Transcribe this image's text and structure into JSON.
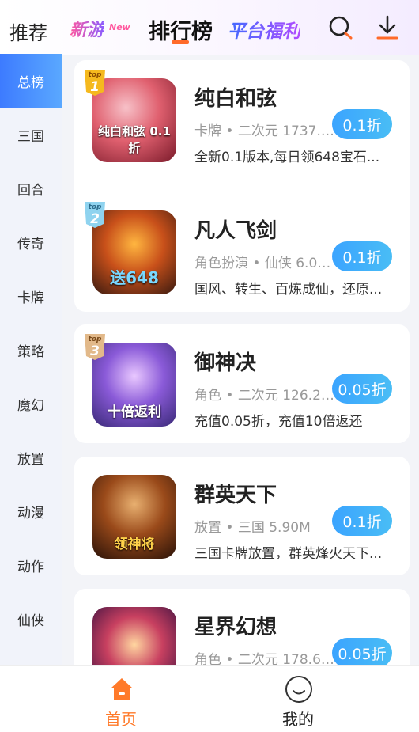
{
  "header": {
    "tabs": {
      "recommend": "推荐",
      "new_games": "新游",
      "new_games_badge": "New",
      "ranking": "排行榜",
      "welfare": "平台福利"
    },
    "icons": [
      "search-icon",
      "download-icon"
    ],
    "accent_color": "#ff6a2a"
  },
  "sidebar": {
    "items": [
      {
        "label": "总榜",
        "active": true
      },
      {
        "label": "三国"
      },
      {
        "label": "回合"
      },
      {
        "label": "传奇"
      },
      {
        "label": "卡牌"
      },
      {
        "label": "策略"
      },
      {
        "label": "魔幻"
      },
      {
        "label": "放置"
      },
      {
        "label": "动漫"
      },
      {
        "label": "动作"
      },
      {
        "label": "仙侠"
      }
    ],
    "active_color": "#3d7bff"
  },
  "games": [
    {
      "rank_top": "top",
      "rank": "1",
      "title": "纯白和弦",
      "meta": "卡牌 • 二次元 1737.4...",
      "desc": "全新0.1版本,每日领648宝石...",
      "discount": "0.1折",
      "thumb_caption": "纯白和弦 0.1折"
    },
    {
      "rank_top": "top",
      "rank": "2",
      "title": "凡人飞剑",
      "meta": "角色扮演 • 仙侠 6.00...",
      "desc": "国风、转生、百炼成仙，还原...",
      "discount": "0.1折",
      "thumb_caption": "送648"
    },
    {
      "rank_top": "top",
      "rank": "3",
      "title": "御神决",
      "meta": "角色 • 二次元 126.25...",
      "desc": "充值0.05折，充值10倍返还",
      "discount": "0.05折",
      "thumb_caption": "十倍返利"
    },
    {
      "title": "群英天下",
      "meta": "放置 • 三国 5.90M",
      "desc": "三国卡牌放置，群英烽火天下...",
      "discount": "0.1折",
      "thumb_caption": "领神将"
    },
    {
      "title": "星界幻想",
      "meta": "角色 • 二次元 178.66...",
      "desc": "",
      "discount": "0.05折",
      "thumb_caption": ""
    }
  ],
  "bottom_nav": {
    "home": "首页",
    "mine": "我的",
    "active_color": "#ff7a2a"
  }
}
